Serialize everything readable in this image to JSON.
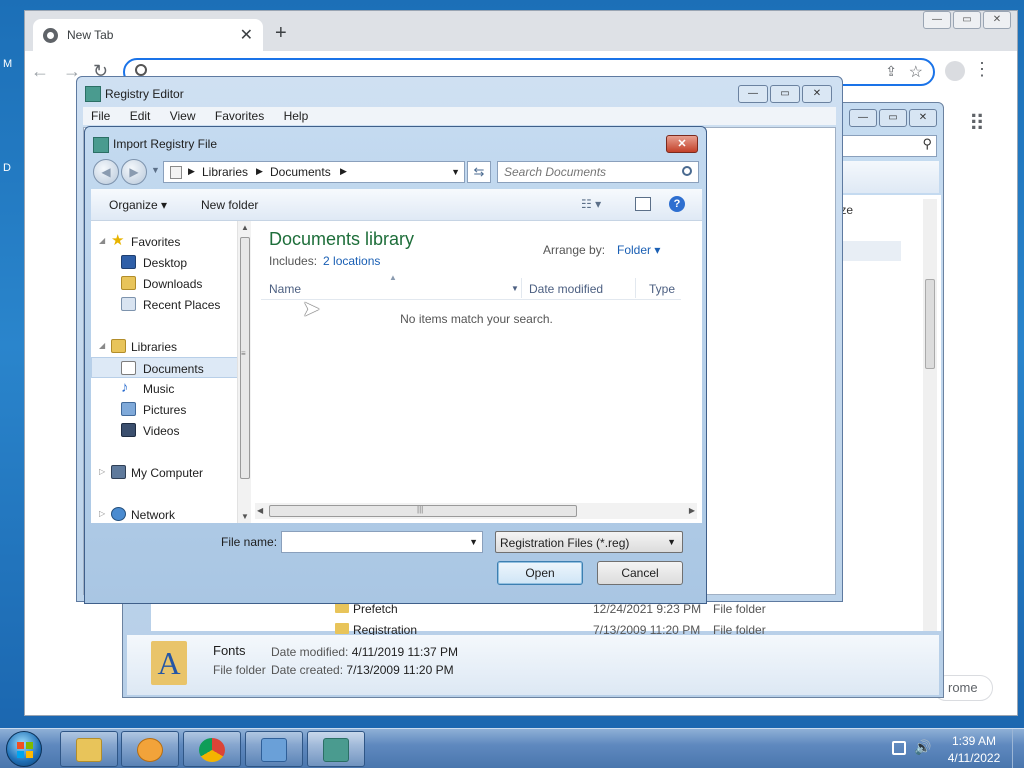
{
  "desktop": {
    "edge_glyph_1": "M",
    "edge_glyph_2": "D"
  },
  "chrome": {
    "tab_title": "New Tab",
    "tab_close": "✕",
    "new_tab": "+",
    "back": "←",
    "forward": "→",
    "reload": "↻",
    "share": "⇪",
    "star": "☆",
    "menu": "⋮",
    "apps": "⠿",
    "chip_text": "rome",
    "window_buttons": [
      "—",
      "▭",
      "✕"
    ]
  },
  "explorer": {
    "window_buttons": [
      "—",
      "▭",
      "✕"
    ],
    "search_icon": "⚲",
    "partial_label": "ze",
    "rows": [
      {
        "name": "Prefetch",
        "date": "12/24/2021 9:23 PM",
        "type": "File folder"
      },
      {
        "name": "Registration",
        "date": "7/13/2009 11:20 PM",
        "type": "File folder"
      }
    ],
    "details": {
      "icon_letter": "A",
      "name": "Fonts",
      "type": "File folder",
      "modified_label": "Date modified:",
      "modified_value": "4/11/2019 11:37 PM",
      "created_label": "Date created:",
      "created_value": "7/13/2009 11:20 PM"
    }
  },
  "regedit": {
    "title": "Registry Editor",
    "window_buttons": [
      "—",
      "▭",
      "✕"
    ],
    "menu": [
      "File",
      "Edit",
      "View",
      "Favorites",
      "Help"
    ]
  },
  "dialog": {
    "title": "Import Registry File",
    "close": "✕",
    "breadcrumb": [
      "Libraries",
      "Documents"
    ],
    "search_placeholder": "Search Documents",
    "toolbar": {
      "organize": "Organize ▾",
      "new_folder": "New folder",
      "views": "☷ ▾",
      "help": "?"
    },
    "nav": {
      "favorites": "Favorites",
      "desktop": "Desktop",
      "downloads": "Downloads",
      "recent_places": "Recent Places",
      "libraries": "Libraries",
      "documents": "Documents",
      "music": "Music",
      "pictures": "Pictures",
      "videos": "Videos",
      "my_computer": "My Computer",
      "network": "Network"
    },
    "content": {
      "library_title": "Documents library",
      "includes_label": "Includes:",
      "includes_link": "2 locations",
      "arrange_label": "Arrange by:",
      "arrange_value": "Folder ▾",
      "columns": [
        "Name",
        "Date modified",
        "Type"
      ],
      "empty_message": "No items match your search."
    },
    "file_name_label": "File name:",
    "file_name_value": "",
    "file_type_value": "Registration Files (*.reg)",
    "open_button": "Open",
    "cancel_button": "Cancel"
  },
  "taskbar": {
    "time": "1:39 AM",
    "date": "4/11/2022",
    "volume_icon": "🔊"
  }
}
